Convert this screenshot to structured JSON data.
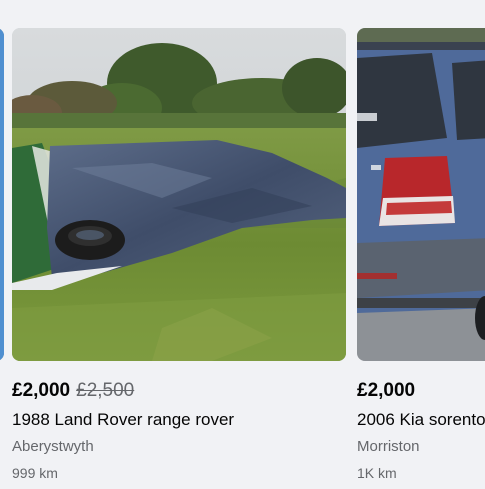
{
  "listings": [
    {
      "price": "£2,000",
      "old_price": "£2,500",
      "title": "1988 Land Rover range rover",
      "location": "Aberystwyth",
      "distance": "999 km",
      "photo_icon": "car-under-tarp-photo"
    },
    {
      "price": "£2,000",
      "old_price": "",
      "title": "2006 Kia sorento",
      "location": "Morriston",
      "distance": "1K km",
      "photo_icon": "blue-suv-rear-photo"
    }
  ]
}
